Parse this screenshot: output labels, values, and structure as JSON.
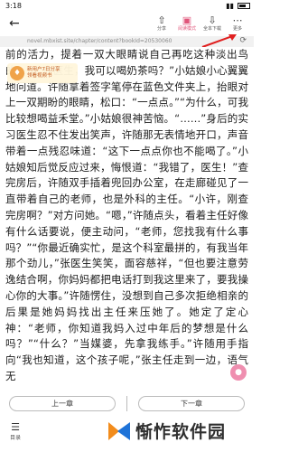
{
  "status": {
    "time": "3:18",
    "battery": "57"
  },
  "toolbar": {
    "tools": [
      {
        "label": "分享",
        "icon": "share-icon"
      },
      {
        "label": "阅读模式",
        "icon": "reader-mode-icon"
      },
      {
        "label": "全本下载",
        "icon": "download-icon"
      },
      {
        "label": "更多",
        "icon": "more-icon"
      }
    ]
  },
  "url": "novel.mbxist.site/chapter/content?bookId=20530060",
  "promo": {
    "line1": "新用户7日分享",
    "line2": "领看视频书"
  },
  "content": {
    "paragraphs": [
      "前的活力，提着一双大眼睛说自己再吃这种淡出鸟的……“许医生，我可以喝奶茶吗？”小姑娘小心翼翼地问道。许随拿着签字笔停在蓝色文件夹上，抬眼对上一双期盼的眼睛，松口：“一点点。”“为什么，可我比较想喝益禾堂。”小姑娘很神苦恼。“……”身后的实习医生忍不住发出笑声，许随那无表情地开口，声音带着一点残忍味道：“这下一点点你也不能喝了。”小姑娘知后觉反应过来，悔恨道：“我错了，医生！”查完房后，许随双手插着兜回办公室，在走廊碰见了一直带着自己的老师，也是外科的主任。“小许，刚查完房啊？”对方问她。“嗯，”许随点头，看着主任好像有什么话要说，便主动问，“老师，您找我有什么事吗？”“你最近确实忙，是这个科室最拼的，有我当年那个劲儿，”张医生笑笑，面容慈祥，“但也要注意劳逸结合啊，你妈妈都把电话打到我这里来了，要我操心你的大事。”许随愣住，没想到自己多次拒绝相亲的后果是她妈妈找出主任来压她了。她定了定心神：“老师，你知道我妈入过中年后的梦想是什么吗？”“什么？”当媒婆，先拿我练手。”许随用手指向“我也知道，这个孩子呢，”张主任走到一边，语气无"
    ]
  },
  "navigation": {
    "prev_label": "上一章",
    "next_label": "下一章"
  },
  "bottom": {
    "directory_label": "目录"
  },
  "watermark": {
    "text": "惭怍软件园"
  }
}
